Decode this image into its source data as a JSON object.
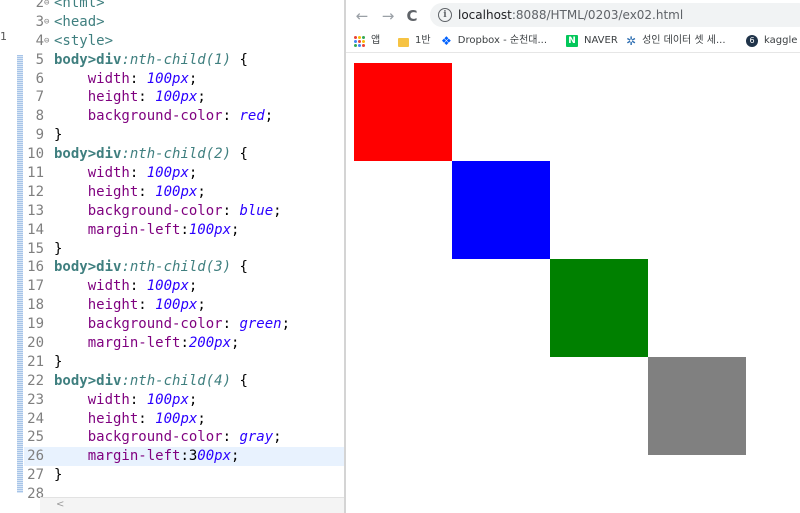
{
  "editor": {
    "left_edge_marker": "1",
    "lines": [
      {
        "num": "2",
        "fold": "⊖",
        "tokens": [
          [
            "tag",
            "<html>"
          ]
        ]
      },
      {
        "num": "3",
        "fold": "⊖",
        "tokens": [
          [
            "tag",
            "<head>"
          ]
        ]
      },
      {
        "num": "4",
        "fold": "⊖",
        "tokens": [
          [
            "tag",
            "<style>"
          ]
        ]
      },
      {
        "num": "5",
        "tokens": [
          [
            "sel",
            "body>div"
          ],
          [
            "pc",
            ":nth-child(1)"
          ],
          [
            "punc",
            " {"
          ]
        ]
      },
      {
        "num": "6",
        "tokens": [
          [
            "punc",
            "    "
          ],
          [
            "prop",
            "width"
          ],
          [
            "punc",
            ": "
          ],
          [
            "val",
            "100px"
          ],
          [
            "punc",
            ";"
          ]
        ]
      },
      {
        "num": "7",
        "tokens": [
          [
            "punc",
            "    "
          ],
          [
            "prop",
            "height"
          ],
          [
            "punc",
            ": "
          ],
          [
            "val",
            "100px"
          ],
          [
            "punc",
            ";"
          ]
        ]
      },
      {
        "num": "8",
        "tokens": [
          [
            "punc",
            "    "
          ],
          [
            "prop",
            "background-color"
          ],
          [
            "punc",
            ": "
          ],
          [
            "val",
            "red"
          ],
          [
            "punc",
            ";"
          ]
        ]
      },
      {
        "num": "9",
        "tokens": [
          [
            "punc",
            "}"
          ]
        ]
      },
      {
        "num": "10",
        "tokens": [
          [
            "sel",
            "body>div"
          ],
          [
            "pc",
            ":nth-child(2)"
          ],
          [
            "punc",
            " {"
          ]
        ]
      },
      {
        "num": "11",
        "tokens": [
          [
            "punc",
            "    "
          ],
          [
            "prop",
            "width"
          ],
          [
            "punc",
            ": "
          ],
          [
            "val",
            "100px"
          ],
          [
            "punc",
            ";"
          ]
        ]
      },
      {
        "num": "12",
        "tokens": [
          [
            "punc",
            "    "
          ],
          [
            "prop",
            "height"
          ],
          [
            "punc",
            ": "
          ],
          [
            "val",
            "100px"
          ],
          [
            "punc",
            ";"
          ]
        ]
      },
      {
        "num": "13",
        "tokens": [
          [
            "punc",
            "    "
          ],
          [
            "prop",
            "background-color"
          ],
          [
            "punc",
            ": "
          ],
          [
            "val",
            "blue"
          ],
          [
            "punc",
            ";"
          ]
        ]
      },
      {
        "num": "14",
        "tokens": [
          [
            "punc",
            "    "
          ],
          [
            "prop",
            "margin-left"
          ],
          [
            "punc",
            ":"
          ],
          [
            "val",
            "100px"
          ],
          [
            "punc",
            ";"
          ]
        ]
      },
      {
        "num": "15",
        "tokens": [
          [
            "punc",
            "}"
          ]
        ]
      },
      {
        "num": "16",
        "tokens": [
          [
            "sel",
            "body>div"
          ],
          [
            "pc",
            ":nth-child(3)"
          ],
          [
            "punc",
            " {"
          ]
        ]
      },
      {
        "num": "17",
        "tokens": [
          [
            "punc",
            "    "
          ],
          [
            "prop",
            "width"
          ],
          [
            "punc",
            ": "
          ],
          [
            "val",
            "100px"
          ],
          [
            "punc",
            ";"
          ]
        ]
      },
      {
        "num": "18",
        "tokens": [
          [
            "punc",
            "    "
          ],
          [
            "prop",
            "height"
          ],
          [
            "punc",
            ": "
          ],
          [
            "val",
            "100px"
          ],
          [
            "punc",
            ";"
          ]
        ]
      },
      {
        "num": "19",
        "tokens": [
          [
            "punc",
            "    "
          ],
          [
            "prop",
            "background-color"
          ],
          [
            "punc",
            ": "
          ],
          [
            "val",
            "green"
          ],
          [
            "punc",
            ";"
          ]
        ]
      },
      {
        "num": "20",
        "tokens": [
          [
            "punc",
            "    "
          ],
          [
            "prop",
            "margin-left"
          ],
          [
            "punc",
            ":"
          ],
          [
            "val",
            "200px"
          ],
          [
            "punc",
            ";"
          ]
        ]
      },
      {
        "num": "21",
        "tokens": [
          [
            "punc",
            "}"
          ]
        ]
      },
      {
        "num": "22",
        "tokens": [
          [
            "sel",
            "body>div"
          ],
          [
            "pc",
            ":nth-child(4)"
          ],
          [
            "punc",
            " {"
          ]
        ]
      },
      {
        "num": "23",
        "tokens": [
          [
            "punc",
            "    "
          ],
          [
            "prop",
            "width"
          ],
          [
            "punc",
            ": "
          ],
          [
            "val",
            "100px"
          ],
          [
            "punc",
            ";"
          ]
        ]
      },
      {
        "num": "24",
        "tokens": [
          [
            "punc",
            "    "
          ],
          [
            "prop",
            "height"
          ],
          [
            "punc",
            ": "
          ],
          [
            "val",
            "100px"
          ],
          [
            "punc",
            ";"
          ]
        ]
      },
      {
        "num": "25",
        "tokens": [
          [
            "punc",
            "    "
          ],
          [
            "prop",
            "background-color"
          ],
          [
            "punc",
            ": "
          ],
          [
            "val",
            "gray"
          ],
          [
            "punc",
            ";"
          ]
        ]
      },
      {
        "num": "26",
        "current": true,
        "tokens": [
          [
            "punc",
            "    "
          ],
          [
            "prop",
            "margin-left"
          ],
          [
            "punc",
            ":3"
          ],
          [
            "val",
            "00px"
          ],
          [
            "punc",
            ";"
          ]
        ]
      },
      {
        "num": "27",
        "tokens": [
          [
            "punc",
            "}"
          ]
        ]
      },
      {
        "num": "28",
        "tokens": []
      }
    ],
    "hscroll_arrow": "<"
  },
  "browser": {
    "back_icon": "←",
    "forward_icon": "→",
    "reload_icon": "C",
    "info_icon": "i",
    "url_host": "localhost",
    "url_path": ":8088/HTML/0203/ex02.html",
    "bookmarks": [
      {
        "icon": "apps-icon",
        "label": "앱"
      },
      {
        "icon": "folder-icon",
        "label": "1반"
      },
      {
        "icon": "dropbox-icon",
        "label": "Dropbox - 순천대..."
      },
      {
        "icon": "naver-icon",
        "label": "NAVER",
        "icon_text": "N"
      },
      {
        "icon": "star-icon",
        "label": "성인 데이터 셋 세..."
      },
      {
        "icon": "kaggle-icon",
        "label": "kaggle l",
        "icon_text": "6"
      }
    ]
  },
  "page_boxes": [
    {
      "name": "red",
      "color": "#ff0000"
    },
    {
      "name": "blue",
      "color": "#0000ff"
    },
    {
      "name": "green",
      "color": "#008000"
    },
    {
      "name": "gray",
      "color": "#808080"
    }
  ]
}
